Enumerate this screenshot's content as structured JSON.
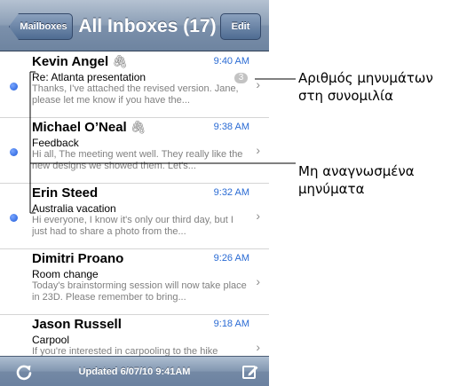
{
  "navbar": {
    "back_label": "Mailboxes",
    "title": "All Inboxes (17)",
    "edit_label": "Edit"
  },
  "messages": [
    {
      "sender": "Kevin Angel",
      "attachment": true,
      "time": "9:40 AM",
      "subject": "Re: Atlanta presentation",
      "preview": "Thanks, I've attached the revised version. Jane, please let me know if you have the...",
      "unread": true,
      "thread_count": "3"
    },
    {
      "sender": "Michael O’Neal",
      "attachment": true,
      "time": "9:38 AM",
      "subject": "Feedback",
      "preview": "Hi all, The meeting went well. They really like the new designs we showed them. Let's...",
      "unread": true,
      "thread_count": ""
    },
    {
      "sender": "Erin Steed",
      "attachment": false,
      "time": "9:32 AM",
      "subject": "Australia vacation",
      "preview": "Hi everyone, I know it's only our third day, but I just had to share a photo from the...",
      "unread": true,
      "thread_count": ""
    },
    {
      "sender": "Dimitri Proano",
      "attachment": false,
      "time": "9:26 AM",
      "subject": "Room change",
      "preview": "Today's brainstorming session will now take place in 23D. Please remember to bring...",
      "unread": false,
      "thread_count": ""
    },
    {
      "sender": "Jason Russell",
      "attachment": false,
      "time": "9:18 AM",
      "subject": "Carpool",
      "preview": "If you're interested in carpooling to the hike",
      "unread": false,
      "thread_count": ""
    }
  ],
  "toolbar": {
    "status": "Updated 6/07/10 9:41AM",
    "refresh_icon": "refresh-icon",
    "compose_icon": "compose-icon"
  },
  "callouts": {
    "thread_count_line1": "Αριθμός μηνυμάτων",
    "thread_count_line2": "στη συνομιλία",
    "unread_line1": "Μη αναγνωσμένα",
    "unread_line2": "μηνύματα"
  },
  "colors": {
    "accent_time": "#2a6bd4",
    "unread_dot": "#1f5bd8",
    "navbar": "#8196b0"
  }
}
